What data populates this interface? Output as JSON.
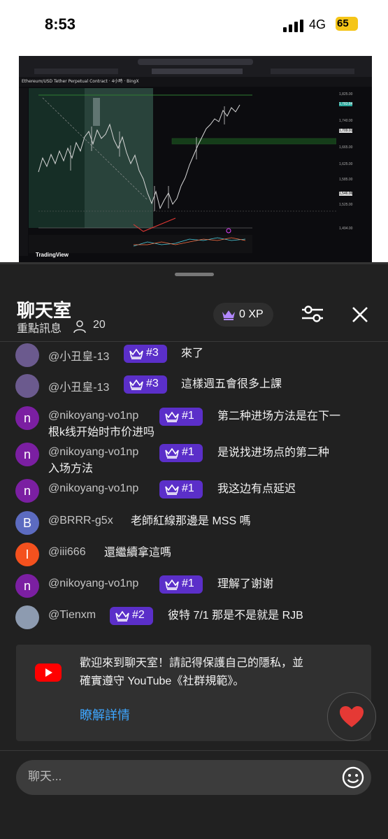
{
  "status_bar": {
    "time": "8:53",
    "network": "4G",
    "battery": "65"
  },
  "video": {
    "tv_symbol": "Ethereum/USD Tether Perpetual Contract · 4小時 · BingX",
    "tv_logo": "TradingView",
    "price_labels": [
      "1,825.00",
      "1,783.84",
      "1,740.00",
      "1,709.91",
      "1,665.00",
      "1,625.00",
      "1,585.00",
      "1,546.96",
      "1,525.00",
      "1,494.00"
    ]
  },
  "chat_header": {
    "title": "聊天室",
    "subtitle": "重點訊息",
    "viewers": "20",
    "xp": "0 XP"
  },
  "messages": [
    {
      "initial": "",
      "avatar_color": "#6b5a8e",
      "author": "@小丑皇-13",
      "rank": "#3",
      "text": "來了"
    },
    {
      "initial": "",
      "avatar_color": "#6b5a8e",
      "author": "@小丑皇-13",
      "rank": "#3",
      "text": "這樣週五會很多上課"
    },
    {
      "initial": "n",
      "avatar_color": "#7b1fa2",
      "author": "@nikoyang-vo1np",
      "rank": "#1",
      "text": "第二种进场方法是在下一根k线开始时市价进吗"
    },
    {
      "initial": "n",
      "avatar_color": "#7b1fa2",
      "author": "@nikoyang-vo1np",
      "rank": "#1",
      "text": "是说找进场点的第二种入场方法"
    },
    {
      "initial": "n",
      "avatar_color": "#7b1fa2",
      "author": "@nikoyang-vo1np",
      "rank": "#1",
      "text": "我这边有点延迟"
    },
    {
      "initial": "B",
      "avatar_color": "#5c6bc0",
      "author": "@BRRR-g5x",
      "rank": "",
      "text": "老師紅線那邊是 MSS 嗎"
    },
    {
      "initial": "I",
      "avatar_color": "#f4511e",
      "author": "@iii666",
      "rank": "",
      "text": "還繼續拿這嗎"
    },
    {
      "initial": "n",
      "avatar_color": "#7b1fa2",
      "author": "@nikoyang-vo1np",
      "rank": "#1",
      "text": "理解了谢谢"
    },
    {
      "initial": "",
      "avatar_color": "#8d9bb0",
      "author": "@Tienxm",
      "rank": "#2",
      "text": "彼特 7/1 那是不是就是 RJB"
    }
  ],
  "welcome": {
    "text": "歡迎來到聊天室！請記得保護自己的隱私，並確實遵守 YouTube《社群規範》。",
    "link": "瞭解詳情"
  },
  "chat_input": {
    "placeholder": "聊天..."
  },
  "colors": {
    "panel": "#212121",
    "badge": "#5b2fc9",
    "link": "#3ea6ff",
    "youtube_red": "#ff0000",
    "heart": "#e53935"
  }
}
